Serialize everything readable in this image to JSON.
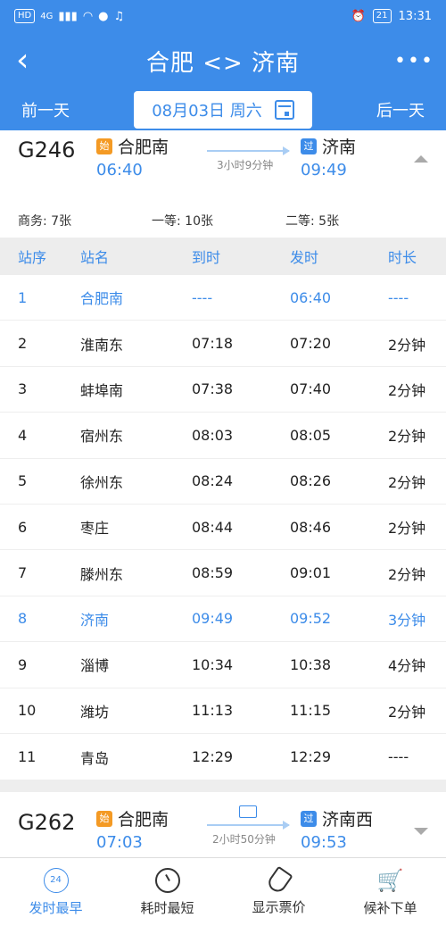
{
  "status": {
    "left_chips": [
      "HD",
      "4G"
    ],
    "battery": "21",
    "clock": "13:31"
  },
  "header": {
    "title": "合肥 <> 济南"
  },
  "datebar": {
    "prev": "前一天",
    "date": "08月03日 周六",
    "next": "后一天"
  },
  "train1": {
    "number": "G246",
    "from_tag": "始",
    "from": "合肥南",
    "depart": "06:40",
    "duration": "3小时9分钟",
    "to_tag": "过",
    "to": "济南",
    "arrive": "09:49"
  },
  "seats": {
    "business": "商务: 7张",
    "first": "一等: 10张",
    "second": "二等: 5张"
  },
  "table": {
    "headers": [
      "站序",
      "站名",
      "到时",
      "发时",
      "时长"
    ],
    "rows": [
      [
        "1",
        "合肥南",
        "----",
        "06:40",
        "----"
      ],
      [
        "2",
        "淮南东",
        "07:18",
        "07:20",
        "2分钟"
      ],
      [
        "3",
        "蚌埠南",
        "07:38",
        "07:40",
        "2分钟"
      ],
      [
        "4",
        "宿州东",
        "08:03",
        "08:05",
        "2分钟"
      ],
      [
        "5",
        "徐州东",
        "08:24",
        "08:26",
        "2分钟"
      ],
      [
        "6",
        "枣庄",
        "08:44",
        "08:46",
        "2分钟"
      ],
      [
        "7",
        "滕州东",
        "08:59",
        "09:01",
        "2分钟"
      ],
      [
        "8",
        "济南",
        "09:49",
        "09:52",
        "3分钟"
      ],
      [
        "9",
        "淄博",
        "10:34",
        "10:38",
        "4分钟"
      ],
      [
        "10",
        "潍坊",
        "11:13",
        "11:15",
        "2分钟"
      ],
      [
        "11",
        "青岛",
        "12:29",
        "12:29",
        "----"
      ]
    ],
    "highlighted_rows": [
      0,
      7
    ]
  },
  "train2": {
    "number": "G262",
    "from_tag": "始",
    "from": "合肥南",
    "depart": "07:03",
    "duration": "2小时50分钟",
    "to_tag": "过",
    "to": "济南西",
    "arrive": "09:53"
  },
  "bottom": {
    "tabs": [
      "发时最早",
      "耗时最短",
      "显示票价",
      "候补下单"
    ],
    "clock_badge": "24"
  },
  "colors": {
    "accent": "#3d8ce9",
    "orange": "#f49a24"
  }
}
